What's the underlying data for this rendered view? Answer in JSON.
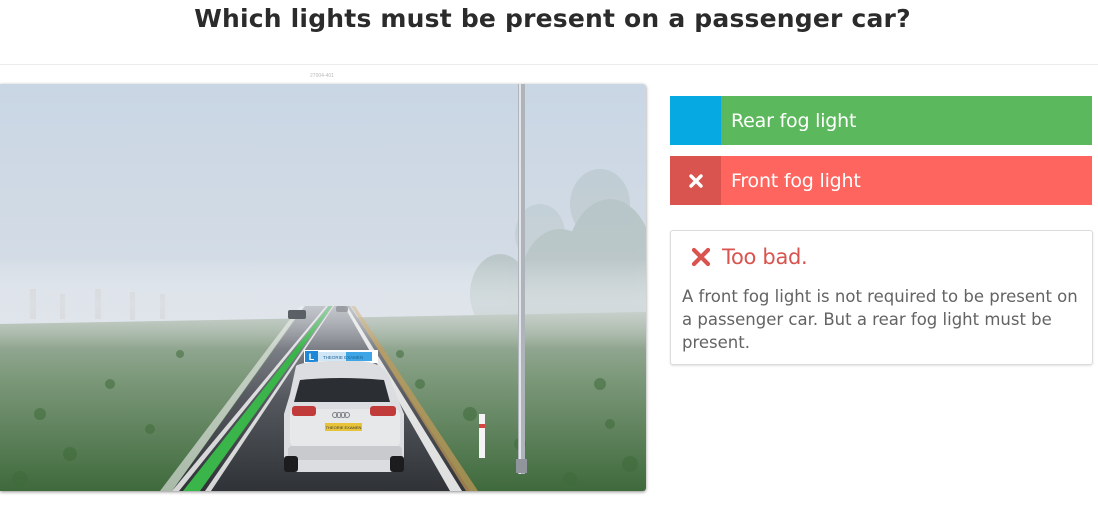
{
  "question": {
    "title": "Which lights must be present on a passenger car?"
  },
  "image": {
    "caption": "27004-401",
    "alt": "Car on a foggy road",
    "car_sign_text": "THEORIE EXAMEN",
    "plate_text": "THEORIE EXAMEN"
  },
  "answers": [
    {
      "label": "Rear fog light",
      "state": "correct",
      "marker_icon": "none",
      "marker_color": "#06a9e2",
      "color": "#5cb85c"
    },
    {
      "label": "Front fog light",
      "state": "wrong-selected",
      "marker_icon": "x-icon",
      "marker_color": "#d9534f",
      "color": "#fe655f"
    }
  ],
  "feedback": {
    "icon": "x-icon",
    "title": "Too bad.",
    "text": "A front fog light is not required to be present on a passenger car. But a rear fog light must be present.",
    "color": "#d9534f"
  }
}
